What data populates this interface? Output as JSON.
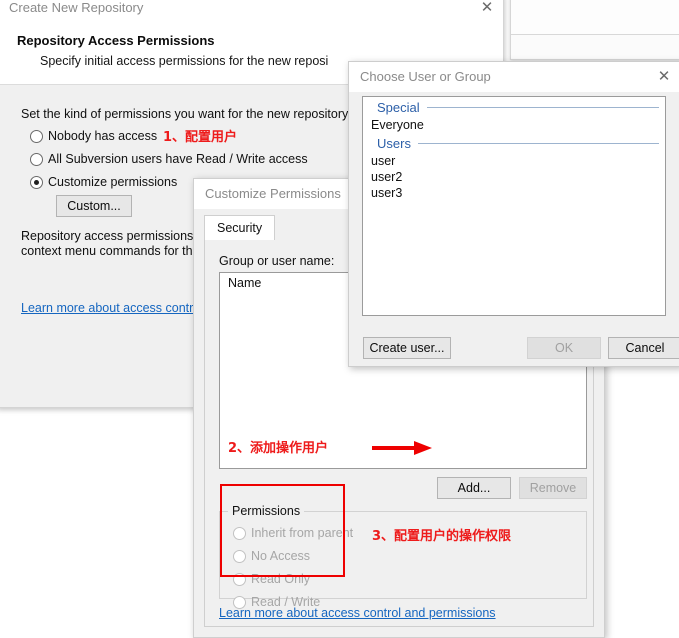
{
  "background_window": {
    "name": "background-dialog"
  },
  "create_repo_window": {
    "title": "Create New Repository",
    "close_label": "✕",
    "header_title": "Repository Access Permissions",
    "header_sub": "Specify initial access permissions for the new reposi",
    "intro_text": "Set the kind of permissions you want for the new repository.",
    "options": [
      {
        "label": "Nobody has access",
        "checked": false
      },
      {
        "label": "All Subversion users have Read / Write access",
        "checked": false
      },
      {
        "label": "Customize permissions",
        "checked": true
      }
    ],
    "custom_button": "Custom...",
    "note_line1": "Repository access permissions can",
    "note_line2": "context menu commands for the cre",
    "learn_more": "Learn more about access control a"
  },
  "customize_window": {
    "title": "Customize Permissions",
    "tab_label": "Security",
    "group_label": "Group or user name:",
    "list_header": "Name",
    "add_button": "Add...",
    "remove_button": "Remove",
    "permissions_group": "Permissions",
    "permissions": [
      {
        "label": "Inherit from parent",
        "checked": false
      },
      {
        "label": "No Access",
        "checked": false
      },
      {
        "label": "Read Only",
        "checked": false
      },
      {
        "label": "Read / Write",
        "checked": false
      }
    ],
    "learn_more": "Learn more about access control and permissions"
  },
  "choose_window": {
    "title": "Choose User or Group",
    "close_label": "✕",
    "groups": [
      {
        "header": "Special",
        "items": [
          "Everyone"
        ]
      },
      {
        "header": "Users",
        "items": [
          "user",
          "user2",
          "user3"
        ]
      }
    ],
    "create_user_button": "Create user...",
    "ok_button": "OK",
    "cancel_button": "Cancel"
  },
  "annotations": {
    "color": "#ee0000",
    "step1": "1、配置用户",
    "step2": "2、添加操作用户",
    "step3": "3、配置用户的操作权限"
  }
}
